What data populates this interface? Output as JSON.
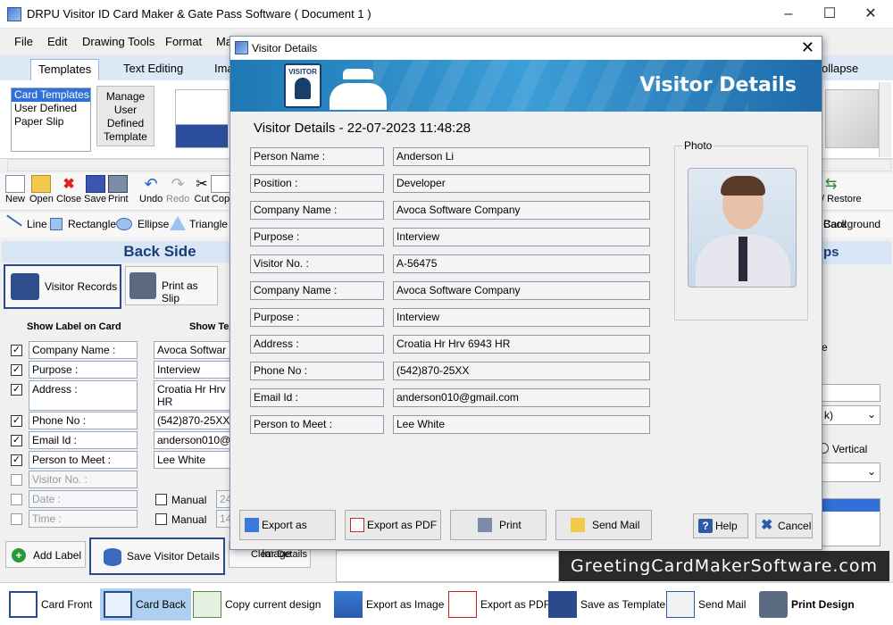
{
  "window": {
    "title": "DRPU Visitor ID Card Maker & Gate Pass Software ( Document 1 )",
    "minimize_icon": "minimize-icon",
    "maximize_icon": "maximize-icon",
    "close_icon": "close-icon"
  },
  "menu": [
    "File",
    "Edit",
    "Drawing Tools",
    "Format",
    "Ma"
  ],
  "ribbon_tabs": [
    "Templates",
    "Text Editing",
    "Ima",
    "ollapse"
  ],
  "templates_list": [
    "Card Templates",
    "User Defined",
    "Paper Slip"
  ],
  "manage_button": [
    "Manage",
    "User",
    "Defined",
    "Template"
  ],
  "toolbar": [
    "New",
    "Open",
    "Close",
    "Save",
    "Print",
    "Undo",
    "Redo",
    "Cut",
    "Cop"
  ],
  "toolbar_right": [
    "/ Restore",
    "Card",
    "Background"
  ],
  "shapes": [
    "Line",
    "Rectangle",
    "Ellipse",
    "Triangle"
  ],
  "left_panel": {
    "title": "Back Side",
    "visitor_records": "Visitor Records",
    "print_as_slip": "Print as Slip",
    "show_label_header": "Show Label on Card",
    "show_text_header": "Show Tex",
    "rows": [
      {
        "label": "Company Name :",
        "value": "Avoca Softwar",
        "checked": true
      },
      {
        "label": "Purpose :",
        "value": "Interview",
        "checked": true
      },
      {
        "label": "Address :",
        "value": "Croatia Hr Hrv",
        "value2": "HR",
        "checked": true
      },
      {
        "label": "Phone No :",
        "value": "(542)870-25XX",
        "checked": true
      },
      {
        "label": "Email Id :",
        "value": "anderson010@",
        "checked": true
      },
      {
        "label": "Person to Meet :",
        "value": "Lee White",
        "checked": true
      },
      {
        "label": "Visitor No. :",
        "value": "",
        "checked": false
      },
      {
        "label": "Date :",
        "value": "Manual",
        "extra": "24",
        "checked": false
      },
      {
        "label": "Time :",
        "value": "Manual",
        "extra": "14",
        "checked": false
      }
    ],
    "add_label": "Add Label",
    "save_visitor_details": "Save Visitor Details",
    "clear_details": "Clear Details"
  },
  "right_panel": {
    "ps": "ps",
    "e": "e",
    "dropdown": "k)",
    "vertical": "Vertical"
  },
  "watermark": "GreetingCardMakerSoftware.com",
  "bottom_bar": [
    "Card Front",
    "Card Back",
    "Copy current design",
    "Export as Image",
    "Export as PDF",
    "Save as Template",
    "Send Mail",
    "Print Design"
  ],
  "dialog": {
    "title": "Visitor Details",
    "banner_title": "Visitor Details",
    "banner_badge": "VISITOR",
    "heading": "Visitor Details - 22-07-2023 11:48:28",
    "fields": [
      {
        "label": "Person Name :",
        "value": "Anderson Li"
      },
      {
        "label": "Position :",
        "value": "Developer"
      },
      {
        "label": "Company Name :",
        "value": "Avoca Software Company"
      },
      {
        "label": "Purpose :",
        "value": "Interview"
      },
      {
        "label": "Visitor No. :",
        "value": "A-56475"
      },
      {
        "label": "Company Name :",
        "value": "Avoca Software Company"
      },
      {
        "label": "Purpose :",
        "value": "Interview"
      },
      {
        "label": "Address :",
        "value": "Croatia Hr Hrv 6943 HR"
      },
      {
        "label": "Phone No :",
        "value": "(542)870-25XX"
      },
      {
        "label": "Email Id :",
        "value": "anderson010@gmail.com"
      },
      {
        "label": "Person to Meet :",
        "value": "Lee White"
      }
    ],
    "photo_caption": "Photo",
    "buttons": {
      "export_image": "Export as Image",
      "export_pdf": "Export as PDF",
      "print": "Print",
      "send_mail": "Send Mail",
      "help": "Help",
      "cancel": "Cancel"
    }
  }
}
